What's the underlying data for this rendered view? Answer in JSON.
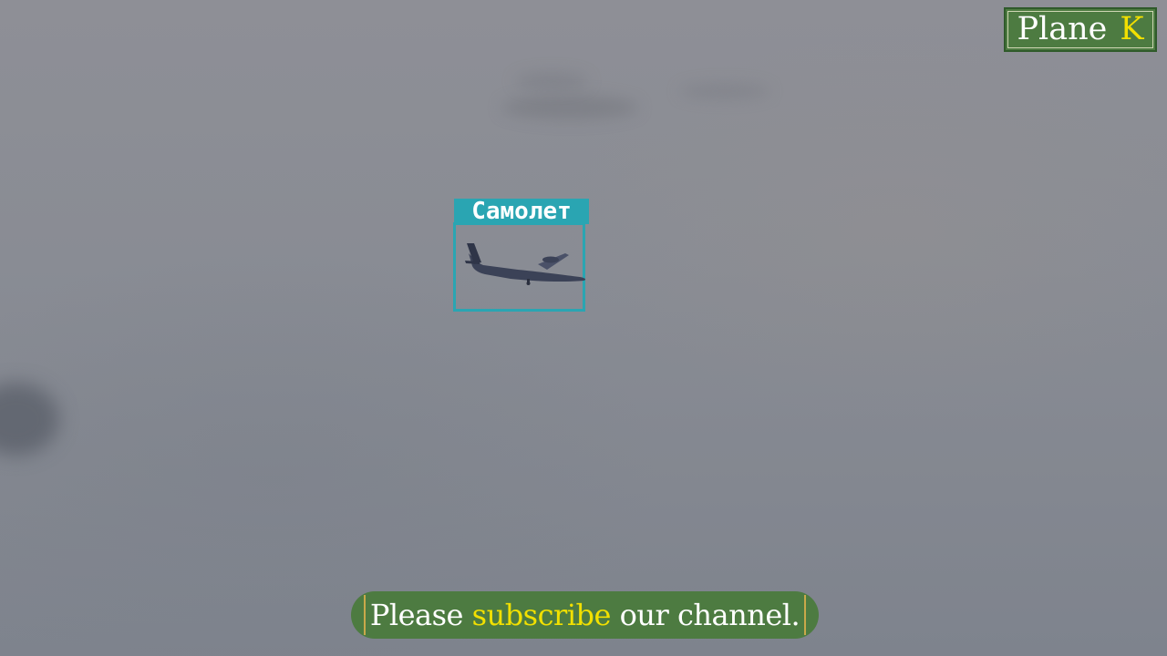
{
  "watermark": {
    "word": "Plane",
    "letter": "K"
  },
  "detection": {
    "label": "Самолет",
    "object": "airplane"
  },
  "subscribe_banner": {
    "before": "Please",
    "highlight": "subscribe",
    "after": "our channel."
  },
  "colors": {
    "sky": "#898c94",
    "banner_green": "#4d7b41",
    "highlight_yellow": "#f2e000",
    "detection_teal": "#2aa5b2"
  },
  "icons": [
    "airplane-icon"
  ]
}
